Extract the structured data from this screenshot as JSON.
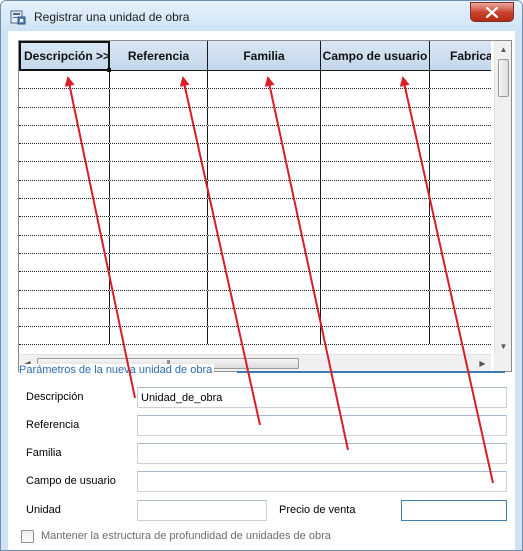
{
  "window": {
    "title": "Registrar una unidad de obra",
    "close_symbol": "✕"
  },
  "grid": {
    "columns": [
      {
        "label": "Descripción >>"
      },
      {
        "label": "Referencia"
      },
      {
        "label": "Familia"
      },
      {
        "label": "Campo de usuario"
      },
      {
        "label": "Fabrica"
      }
    ],
    "empty_rows": 15,
    "scroll_thumb_text": "III"
  },
  "form": {
    "group_title": "Parámetros de la nueva unidad de obra",
    "labels": {
      "descripcion": "Descripción",
      "referencia": "Referencia",
      "familia": "Familia",
      "campo_usuario": "Campo de usuario",
      "unidad": "Unidad",
      "precio_venta": "Precio de venta"
    },
    "values": {
      "descripcion": "Unidad_de_obra",
      "referencia": "",
      "familia": "",
      "campo_usuario": "",
      "unidad": "",
      "precio_venta": ""
    },
    "checkbox_label": "Mantener la estructura de profundidad de unidades de obra",
    "checkbox_checked": false
  },
  "annotation_color": "#d81e2a"
}
